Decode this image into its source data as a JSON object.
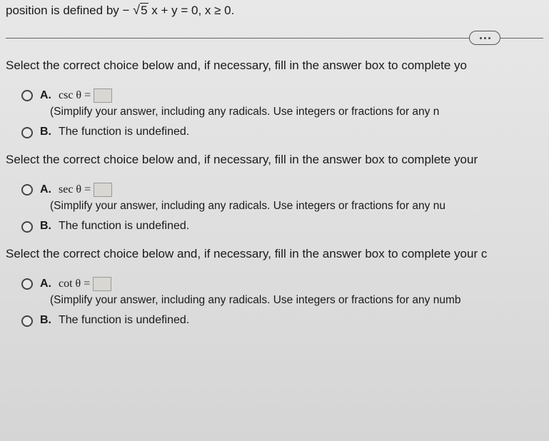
{
  "top_equation_prefix": "position is defined by ",
  "top_equation_neg": "−",
  "top_equation_sqrt": "5",
  "top_equation_rest": " x + y = 0, x ≥ 0.",
  "prompts": {
    "p1": "Select the correct choice below and, if necessary, fill in the answer box to complete yo",
    "p2": "Select the correct choice below and, if necessary, fill in the answer box to complete your",
    "p3": "Select the correct choice below and, if necessary, fill in the answer box to complete your c"
  },
  "choices": {
    "labelA": "A.",
    "labelB": "B.",
    "csc_expr": "csc θ =",
    "sec_expr": "sec θ =",
    "cot_expr": "cot θ =",
    "hint1": "(Simplify your answer, including any radicals. Use integers or fractions for any n",
    "hint2": "(Simplify your answer, including any radicals. Use integers or fractions for any nu",
    "hint3": "(Simplify your answer, including any radicals. Use integers or fractions for any numb",
    "undefined_text": "The function is undefined."
  }
}
